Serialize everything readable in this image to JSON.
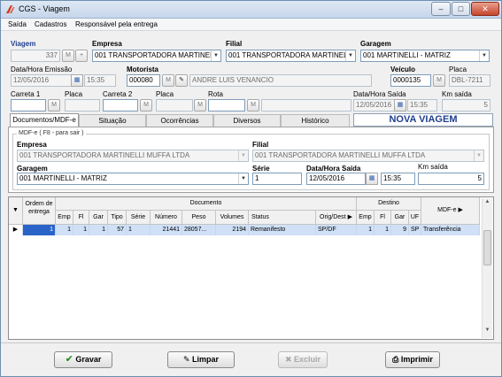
{
  "window": {
    "title": "CGS - Viagem",
    "minimize": "–",
    "maximize": "□",
    "close": "✕"
  },
  "menu": {
    "items": [
      "Saída",
      "Cadastros",
      "Responsável pela entrega"
    ]
  },
  "form": {
    "viagem_label": "Viagem",
    "viagem_value": "337",
    "empresa_label": "Empresa",
    "empresa_value": "001 TRANSPORTADORA MARTINELLI",
    "filial_label": "Filial",
    "filial_value": "001 TRANSPORTADORA MARTINELLI",
    "garagem_label": "Garagem",
    "garagem_value": "001 MARTINELLI - MATRIZ",
    "data_emissao_label": "Data/Hora Emissão",
    "data_emissao_value": "12/05/2016",
    "hora_emissao_value": "15:35",
    "motorista_label": "Motorista",
    "motorista_code": "000080",
    "motorista_name": "ANDRE LUIS VENANCIO",
    "veiculo_label": "Veículo",
    "veiculo_value": "0000135",
    "placa_label": "Placa",
    "placa_value": "DBL-7211",
    "carreta1_label": "Carreta 1",
    "placa1_label": "Placa",
    "carreta2_label": "Carreta 2",
    "placa2_label": "Placa",
    "rota_label": "Rota",
    "data_saida_label": "Data/Hora Saída",
    "data_saida_value": "12/05/2016",
    "hora_saida_value": "15:35",
    "km_saida_label": "Km saída",
    "km_saida_value": "5"
  },
  "tabs": [
    {
      "label": "Documentos/MDF-e",
      "active": true
    },
    {
      "label": "Situação",
      "active": false
    },
    {
      "label": "Ocorrências",
      "active": false
    },
    {
      "label": "Diversos",
      "active": false
    },
    {
      "label": "Histórico",
      "active": false
    }
  ],
  "nova_viagem": "NOVA VIAGEM",
  "mdfe": {
    "legend": "MDF-e ( F8 - para sair )",
    "empresa_label": "Empresa",
    "empresa_value": "001 TRANSPORTADORA MARTINELLI MUFFA LTDA",
    "filial_label": "Filial",
    "filial_value": "001 TRANSPORTADORA MARTINELLI MUFFA LTDA",
    "garagem_label": "Garagem",
    "garagem_value": "001 MARTINELLI - MATRIZ",
    "serie_label": "Série",
    "serie_value": "1",
    "data_saida_label": "Data/Hora Saída",
    "data_saida_value": "12/05/2016",
    "hora_saida_value": "15:35",
    "km_saida_label": "Km saída",
    "km_saida_value": "5"
  },
  "grid": {
    "group_headers": {
      "documento": "Documento",
      "destino": "Destino",
      "mdfe": "MDF-e"
    },
    "ordem_header": "Ordem de entrega",
    "columns": [
      "Emp",
      "Fl",
      "Gar",
      "Tipo",
      "Série",
      "Número",
      "Peso",
      "Volumes",
      "Status",
      "Orig/Dest",
      "Emp",
      "Fl",
      "Gar",
      "UF"
    ],
    "rows": [
      {
        "ordem": "1",
        "emp": "1",
        "fl": "1",
        "gar": "1",
        "tipo": "57",
        "serie": "1",
        "numero": "21441",
        "peso": "28057...",
        "volumes": "2194",
        "status": "Remanifesto",
        "orig_dest": "SP/DF",
        "d_emp": "1",
        "d_fl": "1",
        "d_gar": "9",
        "uf": "SP",
        "mdfe": "Transferência"
      }
    ]
  },
  "buttons": {
    "gravar": "Gravar",
    "limpar": "Limpar",
    "excluir": "Excluir",
    "imprimir": "Imprimir"
  }
}
